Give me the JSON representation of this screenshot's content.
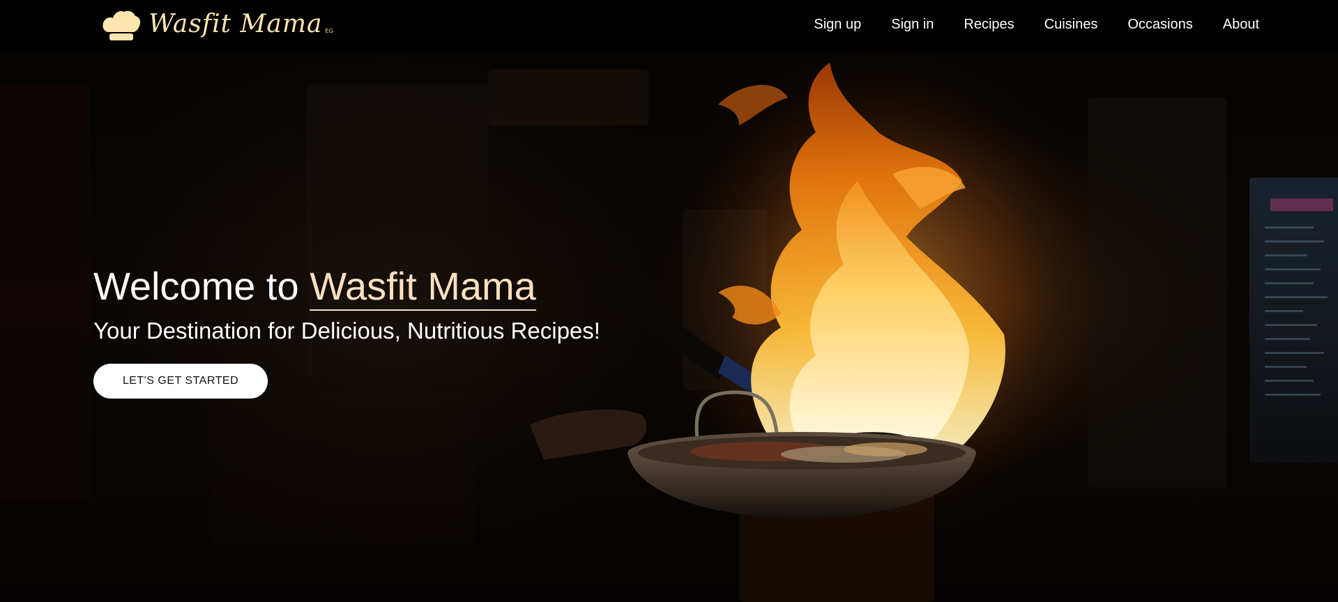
{
  "brand": {
    "name": "Wasfit Mama",
    "suffix": "EG",
    "logo_icon": "chef-hat-icon",
    "color": "#fde5b0"
  },
  "nav": {
    "items": [
      {
        "label": "Sign up"
      },
      {
        "label": "Sign in"
      },
      {
        "label": "Recipes"
      },
      {
        "label": "Cuisines"
      },
      {
        "label": "Occasions"
      },
      {
        "label": "About"
      }
    ]
  },
  "hero": {
    "title_prefix": "Welcome to",
    "title_brand": "Wasfit Mama",
    "subtitle": "Your Destination for Delicious, Nutritious Recipes!",
    "cta_label": "LET'S GET STARTED",
    "background_image": "flaming-pan-photo",
    "accent_color": "#fbe1c0"
  }
}
